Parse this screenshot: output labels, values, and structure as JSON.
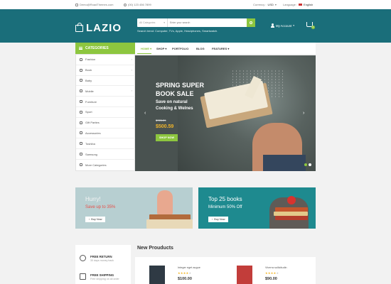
{
  "topbar": {
    "email": "Demo@RoadThemes.com",
    "phone": "(00) 123 456 7899",
    "currency_label": "Currency :",
    "currency_value": "USD",
    "language_label": "Language :",
    "language_value": "English"
  },
  "header": {
    "logo_text": "LAZIO",
    "search_category": "All Categories",
    "search_placeholder": "Enter your search",
    "trend_text": "Search trend: Computer, TVs, Apple, Headphones, Smartwatch.",
    "account_label": "My Account",
    "cart_count": "0"
  },
  "categories": {
    "heading": "CATEGORIES",
    "items": [
      {
        "label": "Fashion",
        "icon": "hanger-icon",
        "has_sub": true
      },
      {
        "label": "Book",
        "icon": "book-icon",
        "has_sub": true
      },
      {
        "label": "Baby",
        "icon": "baby-icon",
        "has_sub": false
      },
      {
        "label": "Mobile",
        "icon": "mobile-icon",
        "has_sub": true
      },
      {
        "label": "Furniture",
        "icon": "chair-icon",
        "has_sub": false
      },
      {
        "label": "Sport",
        "icon": "ball-icon",
        "has_sub": false
      },
      {
        "label": "Gift Parties",
        "icon": "gift-icon",
        "has_sub": false
      },
      {
        "label": "Accessories",
        "icon": "watch-icon",
        "has_sub": false
      },
      {
        "label": "Toshiba",
        "icon": "laptop-icon",
        "has_sub": false
      },
      {
        "label": "Samsung",
        "icon": "tv-icon",
        "has_sub": false
      },
      {
        "label": "More Categories",
        "icon": "plus-icon",
        "has_sub": false
      }
    ]
  },
  "nav": {
    "items": [
      {
        "label": "HOME",
        "has_sub": true,
        "active": true
      },
      {
        "label": "SHOP",
        "has_sub": true,
        "active": false
      },
      {
        "label": "PORTFOLIO",
        "has_sub": false,
        "active": false
      },
      {
        "label": "BLOG",
        "has_sub": false,
        "active": false
      },
      {
        "label": "FEATURES",
        "has_sub": true,
        "active": false
      }
    ]
  },
  "slider": {
    "title_line1": "SPRING SUPER",
    "title_line2": "BOOK SALE",
    "sub_line1": "Save on natural",
    "sub_line2": "Cooking & Welnes",
    "old_price": "$725.29",
    "new_price": "$500.59",
    "button_label": "SHOP NOW",
    "active_slide": 1,
    "slide_count": 2
  },
  "banners": [
    {
      "headline": "Hurry!",
      "sub": "Save up to 35%",
      "button_label": "Buy Now"
    },
    {
      "headline": "Top 25 books",
      "sub": "Minimum 50% Off",
      "button_label": "Buy Now"
    }
  ],
  "features": [
    {
      "title": "FREE RETURN",
      "desc": "30 days money back"
    },
    {
      "title": "FREE SHIPPING",
      "desc": "Free shipping on all order"
    }
  ],
  "new_products": {
    "heading": "New Prouducts",
    "items": [
      {
        "name": "Integer eget augue",
        "price": "$100.00",
        "rating": 4
      },
      {
        "name": "Viverra sollicitudin",
        "price": "$90.00",
        "rating": 4
      }
    ]
  },
  "colors": {
    "brand": "#1a6e7a",
    "accent": "#8dc63f",
    "price": "#f0b429"
  }
}
